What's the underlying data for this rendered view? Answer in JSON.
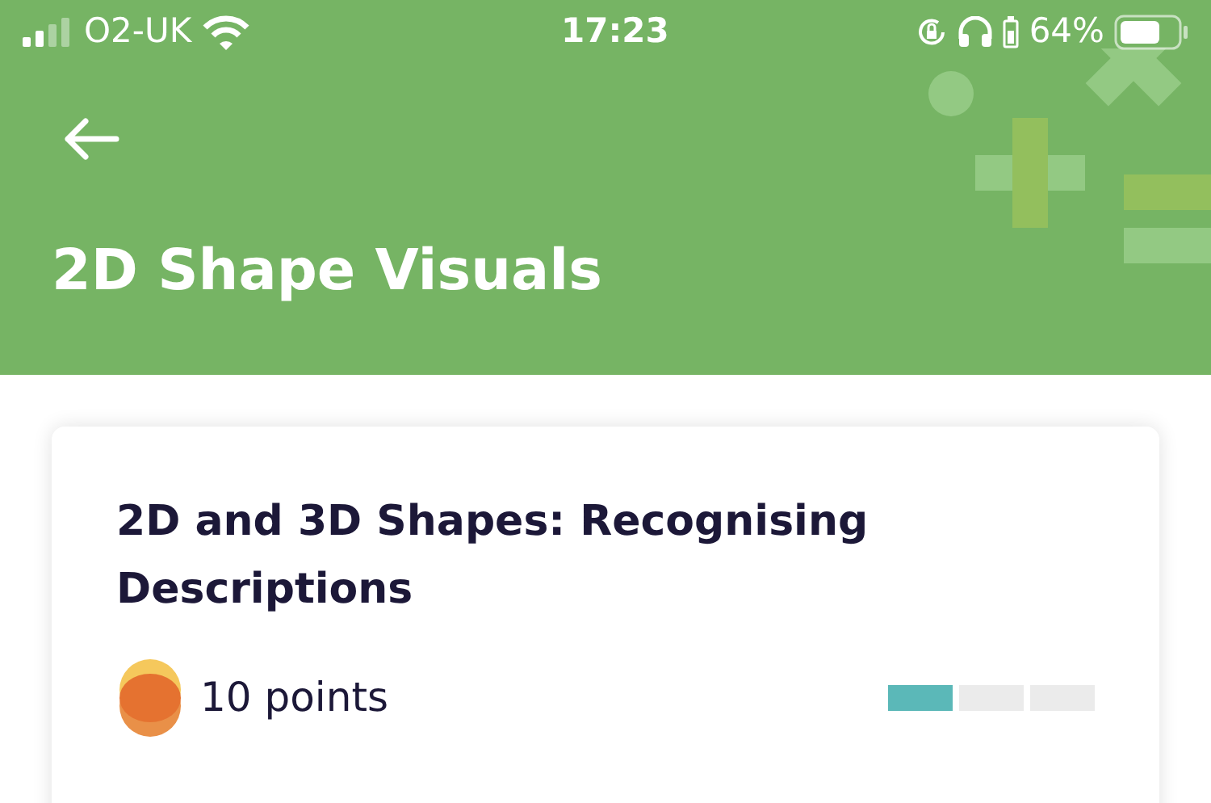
{
  "status_bar": {
    "carrier": "O2-UK",
    "time": "17:23",
    "battery": "64%"
  },
  "header": {
    "title": "2D Shape Visuals"
  },
  "card": {
    "title": "2D and 3D Shapes: Recognising Descriptions",
    "points": "10 points",
    "difficulty": [
      {
        "filled": true
      },
      {
        "filled": false
      },
      {
        "filled": false
      }
    ]
  }
}
